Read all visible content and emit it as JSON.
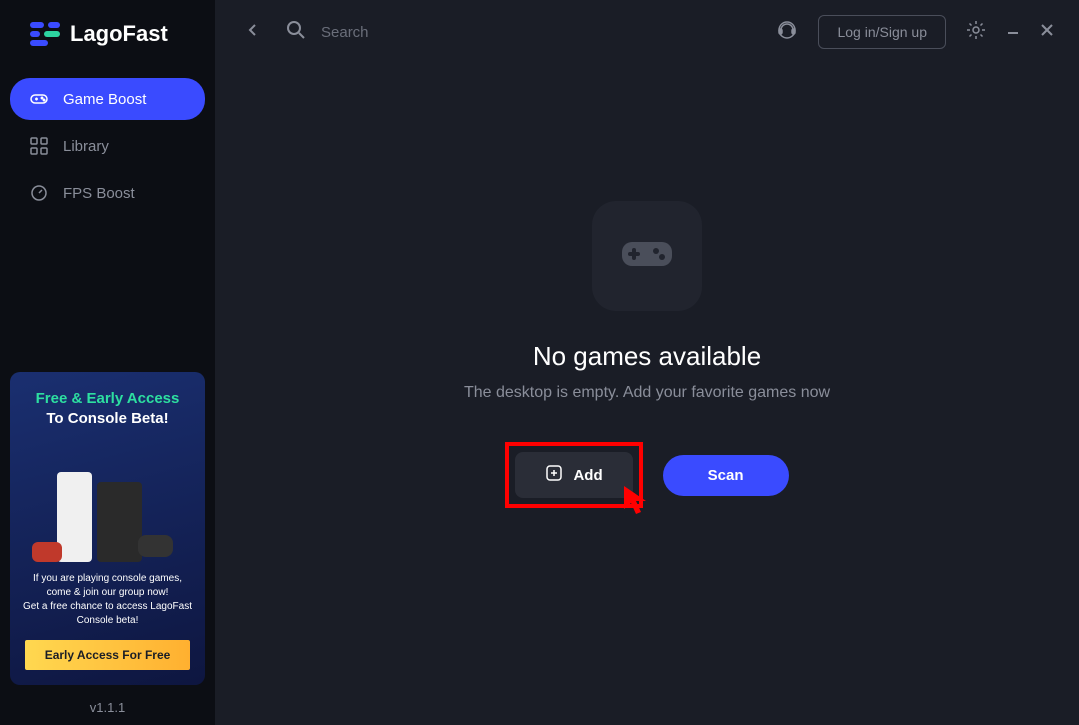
{
  "app": {
    "name": "LagoFast",
    "version": "v1.1.1"
  },
  "sidebar": {
    "items": [
      {
        "label": "Game Boost",
        "active": true
      },
      {
        "label": "Library",
        "active": false
      },
      {
        "label": "FPS Boost",
        "active": false
      }
    ]
  },
  "promo": {
    "title1": "Free & Early Access",
    "title2": "To Console Beta!",
    "text": "If you are playing console games, come & join our group now!\nGet a free chance to access LagoFast Console beta!",
    "button": "Early Access For Free"
  },
  "topbar": {
    "search_placeholder": "Search",
    "login_label": "Log in/Sign up"
  },
  "main": {
    "title": "No games available",
    "subtitle": "The desktop is empty. Add your favorite games now",
    "add_label": "Add",
    "scan_label": "Scan"
  }
}
